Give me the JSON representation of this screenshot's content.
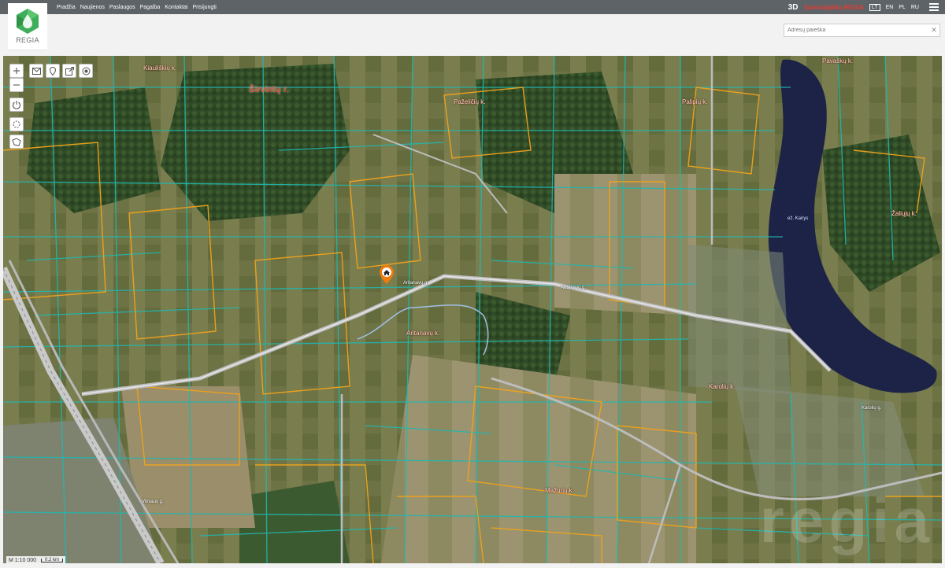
{
  "nav": {
    "items": [
      "Pradžia",
      "Naujienos",
      "Paslaugos",
      "Pagalba",
      "Kontaktai",
      "Prisijungti"
    ]
  },
  "header": {
    "three_d": "3D",
    "brand": "Savivaldybių REGIA",
    "languages": [
      "LT",
      "EN",
      "PL",
      "RU"
    ],
    "active_language": "LT",
    "brand_color": "#e43b31"
  },
  "logo": {
    "text": "REGIA",
    "color": "#3fae5b"
  },
  "search": {
    "placeholder": "Adresų paieška",
    "value": ""
  },
  "map": {
    "labels": {
      "sirvintu": "Širvintų r.",
      "kiaulickiu": "Kiauliškių k.",
      "pazeliku": "Paželičių k.",
      "paliciu": "Palipių k.",
      "aritanavu": "Aritanavų k.",
      "karolu": "Karolių k.",
      "mazuriu": "Mažurių k.",
      "lake": "ež. Kairys",
      "zaliu": "Žaliųjų k.",
      "pavasku": "Pavaškų k."
    },
    "road_labels": [
      "Aritanavų g.",
      "Aritanavų g.",
      "Karolių g.",
      "Vilniaus g."
    ],
    "scale_text": "M 1:10 000",
    "scale_bar": "0.2 km",
    "watermark": "regia",
    "parcel_colors": {
      "teal": "#21b7b0",
      "orange": "#f0a21b",
      "water": "#1c2347"
    }
  }
}
